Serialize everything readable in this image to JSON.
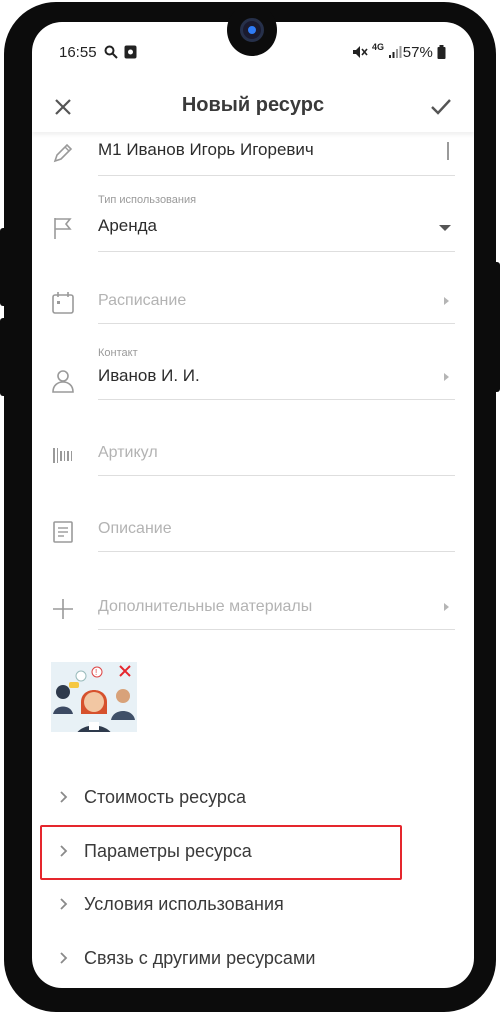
{
  "status_bar": {
    "time": "16:55",
    "network": "4G",
    "battery": "57%"
  },
  "app_bar": {
    "title": "Новый ресурс"
  },
  "form": {
    "name_value": "М1 Иванов Игорь Игоревич",
    "usage_type": {
      "label": "Тип использования",
      "value": "Аренда"
    },
    "schedule": {
      "placeholder": "Расписание"
    },
    "contact": {
      "label": "Контакт",
      "value": "Иванов И. И."
    },
    "article": {
      "placeholder": "Артикул"
    },
    "description": {
      "placeholder": "Описание"
    },
    "materials": {
      "placeholder": "Дополнительные материалы"
    }
  },
  "sections": [
    {
      "label": "Стоимость ресурса"
    },
    {
      "label": "Параметры ресурса"
    },
    {
      "label": "Условия использования"
    },
    {
      "label": "Связь с другими ресурсами"
    }
  ],
  "colors": {
    "highlight": "#e5262d",
    "primary_text": "#2c2c2c",
    "placeholder": "#b3b3b3",
    "divider": "#dedede"
  }
}
